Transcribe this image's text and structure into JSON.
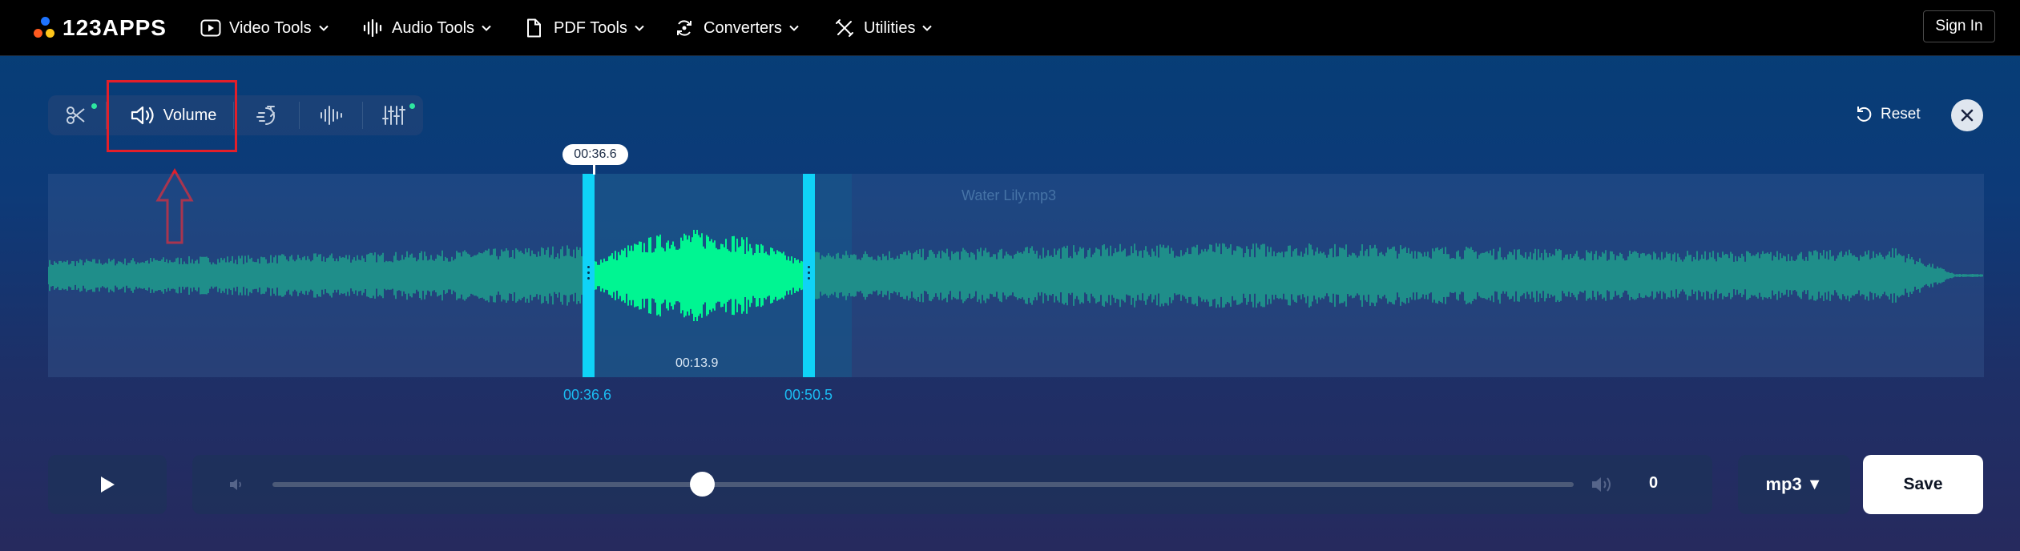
{
  "nav": {
    "brand": "123APPS",
    "items": [
      {
        "label": "Video Tools",
        "icon": "play-square-icon"
      },
      {
        "label": "Audio Tools",
        "icon": "audio-wave-icon"
      },
      {
        "label": "PDF Tools",
        "icon": "document-icon"
      },
      {
        "label": "Converters",
        "icon": "convert-cycle-icon"
      },
      {
        "label": "Utilities",
        "icon": "tools-icon"
      }
    ],
    "sign_in": "Sign In"
  },
  "toolbar": {
    "tools": [
      {
        "name": "trim",
        "icon": "scissors-icon",
        "has_indicator": true
      },
      {
        "name": "volume",
        "label": "Volume",
        "icon": "speaker-icon",
        "active": true
      },
      {
        "name": "speed",
        "icon": "speed-icon"
      },
      {
        "name": "equalizer",
        "icon": "waveform-icon"
      },
      {
        "name": "mixer",
        "icon": "sliders-icon",
        "has_indicator": true
      }
    ],
    "reset_label": "Reset"
  },
  "editor": {
    "file_name": "Water Lily.mp3",
    "cursor_time": "00:36.6",
    "selection_start": "00:36.6",
    "selection_end": "00:50.5",
    "selection_duration": "00:13.9"
  },
  "playback": {
    "volume_value": "0",
    "volume_level": 0.33,
    "format": "mp3",
    "format_arrow": "▼",
    "save_label": "Save"
  },
  "colors": {
    "accent": "#0fd3f7",
    "wave_selected": "#00f592",
    "wave_unselected": "#1f8e8a",
    "highlight": "#e21f2a"
  }
}
